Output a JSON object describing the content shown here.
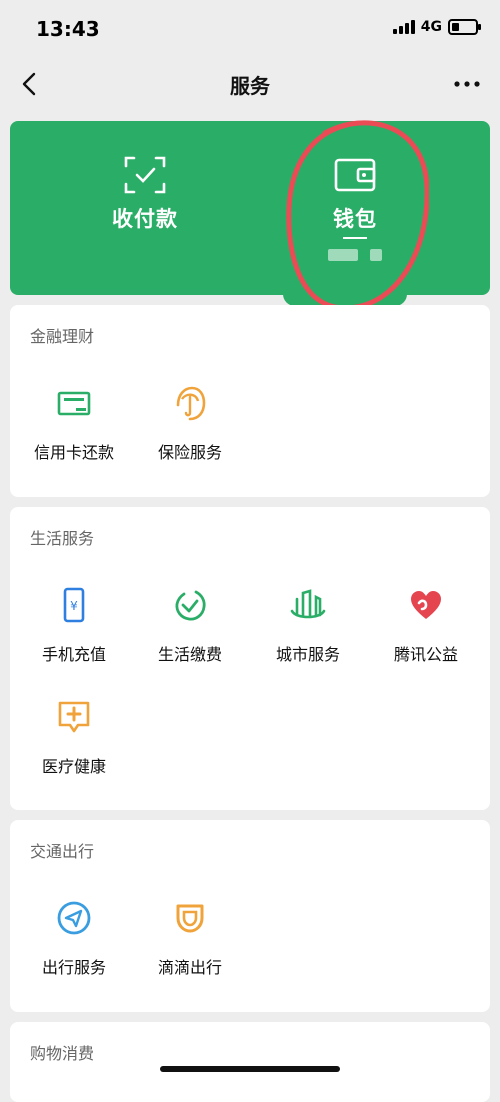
{
  "status": {
    "time": "13:43",
    "network": "4G"
  },
  "nav": {
    "title": "服务"
  },
  "top_card": {
    "pay_label": "收付款",
    "wallet_label": "钱包"
  },
  "sections": {
    "finance": {
      "title": "金融理财",
      "items": [
        {
          "label": "信用卡还款",
          "icon": "credit-card-icon",
          "color": "#2aae67"
        },
        {
          "label": "保险服务",
          "icon": "umbrella-icon",
          "color": "#f0a33a"
        }
      ]
    },
    "life": {
      "title": "生活服务",
      "items": [
        {
          "label": "手机充值",
          "icon": "phone-icon",
          "color": "#2f7fe0"
        },
        {
          "label": "生活缴费",
          "icon": "bill-check-icon",
          "color": "#2aae67"
        },
        {
          "label": "城市服务",
          "icon": "city-icon",
          "color": "#2aae67"
        },
        {
          "label": "腾讯公益",
          "icon": "heart-icon",
          "color": "#e4454f"
        },
        {
          "label": "医疗健康",
          "icon": "medical-chat-icon",
          "color": "#f0a33a"
        }
      ]
    },
    "transport": {
      "title": "交通出行",
      "items": [
        {
          "label": "出行服务",
          "icon": "navigation-icon",
          "color": "#3a9de0"
        },
        {
          "label": "滴滴出行",
          "icon": "didi-icon",
          "color": "#f0a33a"
        }
      ]
    },
    "shopping": {
      "title": "购物消费"
    }
  }
}
